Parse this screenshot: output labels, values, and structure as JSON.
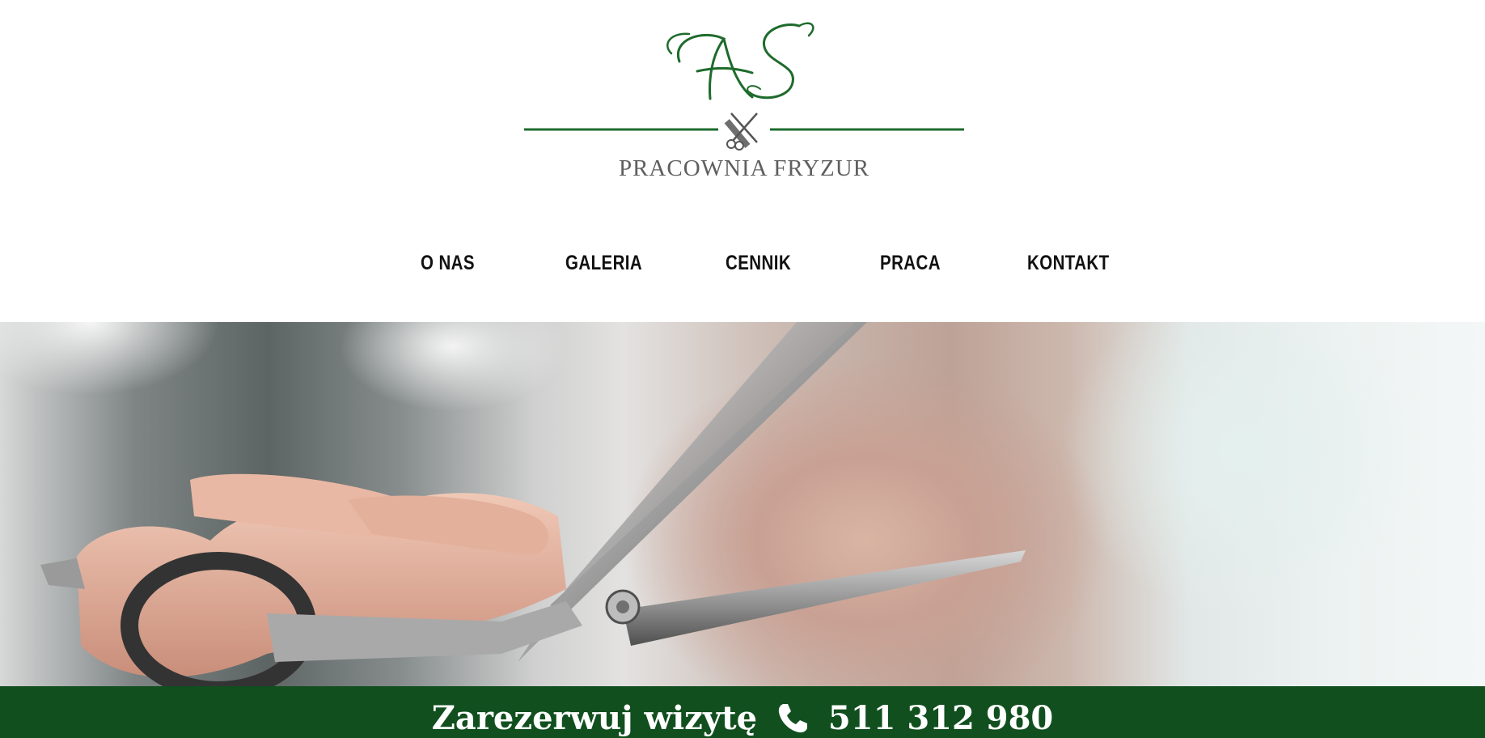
{
  "brand": {
    "monogram": "AS",
    "caption": "PRACOWNIA FRYZUR",
    "accent_color": "#1e6b2c",
    "emblem_icon": "scissors-comb-icon"
  },
  "nav": {
    "items": [
      {
        "label": "O NAS"
      },
      {
        "label": "GALERIA"
      },
      {
        "label": "CENNIK"
      },
      {
        "label": "PRACA"
      },
      {
        "label": "KONTAKT"
      }
    ]
  },
  "hero": {
    "image": "hairdresser-holding-scissors-photo"
  },
  "booking": {
    "label": "Zarezerwuj wizytę",
    "phone_icon": "phone-icon",
    "phone": "511 312 980",
    "background_color": "#114f1f"
  }
}
